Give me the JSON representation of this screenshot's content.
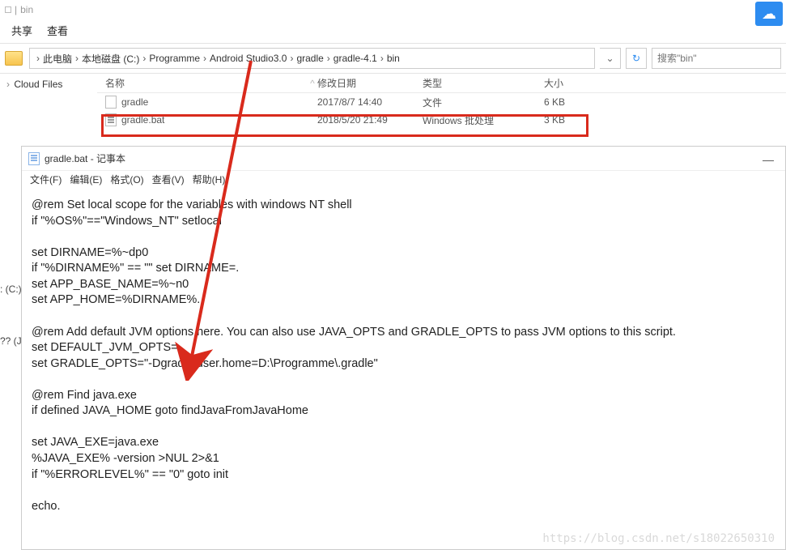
{
  "explorer": {
    "title_context": "bin",
    "ribbon": {
      "share": "共享",
      "view": "查看"
    },
    "breadcrumb": [
      "此电脑",
      "本地磁盘 (C:)",
      "Programme",
      "Android Studio3.0",
      "gradle",
      "gradle-4.1",
      "bin"
    ],
    "breadcrumb_sep": "›",
    "search_placeholder": "搜索\"bin\"",
    "columns": {
      "name": "名称",
      "date": "修改日期",
      "type": "类型",
      "size": "大小"
    },
    "sidebar": {
      "cloud_files": "Cloud Files"
    },
    "files": [
      {
        "name": "gradle",
        "date": "2017/8/7 14:40",
        "type": "文件",
        "size": "6 KB"
      },
      {
        "name": "gradle.bat",
        "date": "2018/5/20 21:49",
        "type": "Windows 批处理",
        "size": "3 KB"
      }
    ]
  },
  "notepad": {
    "title": "gradle.bat - 记事本",
    "menu": {
      "file": "文件(F)",
      "edit": "编辑(E)",
      "format": "格式(O)",
      "view": "查看(V)",
      "help": "帮助(H)"
    },
    "content": "@rem Set local scope for the variables with windows NT shell\nif \"%OS%\"==\"Windows_NT\" setlocal\n\nset DIRNAME=%~dp0\nif \"%DIRNAME%\" == \"\" set DIRNAME=.\nset APP_BASE_NAME=%~n0\nset APP_HOME=%DIRNAME%..\n\n@rem Add default JVM options here. You can also use JAVA_OPTS and GRADLE_OPTS to pass JVM options to this script.\nset DEFAULT_JVM_OPTS=\nset GRADLE_OPTS=\"-Dgradle.user.home=D:\\Programme\\.gradle\"\n\n@rem Find java.exe\nif defined JAVA_HOME goto findJavaFromJavaHome\n\nset JAVA_EXE=java.exe\n%JAVA_EXE% -version >NUL 2>&1\nif \"%ERRORLEVEL%\" == \"0\" goto init\n\necho."
  },
  "left_drive_labels": {
    "c": ": (C:)",
    "j": "?? (J:"
  },
  "watermark": "https://blog.csdn.net/s18022650310"
}
